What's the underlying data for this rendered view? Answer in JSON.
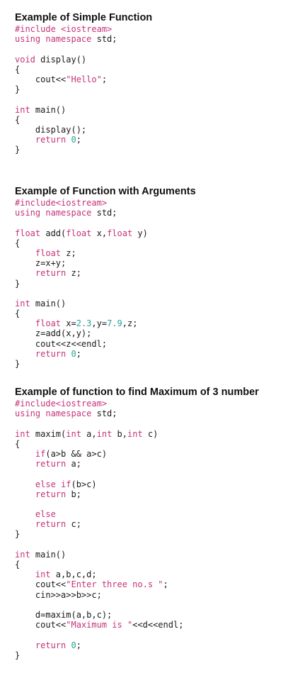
{
  "sections": [
    {
      "title": "Example of Simple Function",
      "lines": [
        [
          {
            "t": "kw",
            "v": "#include <iostream>"
          }
        ],
        [
          {
            "t": "kw",
            "v": "using namespace"
          },
          {
            "t": "tx",
            "v": " std;"
          }
        ],
        [],
        [
          {
            "t": "kw",
            "v": "void"
          },
          {
            "t": "tx",
            "v": " display()"
          }
        ],
        [
          {
            "t": "tx",
            "v": "{"
          }
        ],
        [
          {
            "t": "tx",
            "v": "    cout<<"
          },
          {
            "t": "st",
            "v": "\"Hello\""
          },
          {
            "t": "tx",
            "v": ";"
          }
        ],
        [
          {
            "t": "tx",
            "v": "}"
          }
        ],
        [],
        [
          {
            "t": "kw",
            "v": "int"
          },
          {
            "t": "tx",
            "v": " main()"
          }
        ],
        [
          {
            "t": "tx",
            "v": "{"
          }
        ],
        [
          {
            "t": "tx",
            "v": "    display();"
          }
        ],
        [
          {
            "t": "kw",
            "v": "    return"
          },
          {
            "t": "tx",
            "v": " "
          },
          {
            "t": "nm",
            "v": "0"
          },
          {
            "t": "tx",
            "v": ";"
          }
        ],
        [
          {
            "t": "tx",
            "v": "}"
          }
        ]
      ]
    },
    {
      "title": "Example of Function with Arguments",
      "lines": [
        [
          {
            "t": "kw",
            "v": "#include<iostream>"
          }
        ],
        [
          {
            "t": "kw",
            "v": "using namespace"
          },
          {
            "t": "tx",
            "v": " std;"
          }
        ],
        [],
        [
          {
            "t": "kw",
            "v": "float"
          },
          {
            "t": "tx",
            "v": " add("
          },
          {
            "t": "kw",
            "v": "float"
          },
          {
            "t": "tx",
            "v": " x,"
          },
          {
            "t": "kw",
            "v": "float"
          },
          {
            "t": "tx",
            "v": " y)"
          }
        ],
        [
          {
            "t": "tx",
            "v": "{"
          }
        ],
        [
          {
            "t": "kw",
            "v": "    float"
          },
          {
            "t": "tx",
            "v": " z;"
          }
        ],
        [
          {
            "t": "tx",
            "v": "    z=x+y;"
          }
        ],
        [
          {
            "t": "kw",
            "v": "    return"
          },
          {
            "t": "tx",
            "v": " z;"
          }
        ],
        [
          {
            "t": "tx",
            "v": "}"
          }
        ],
        [],
        [
          {
            "t": "kw",
            "v": "int"
          },
          {
            "t": "tx",
            "v": " main()"
          }
        ],
        [
          {
            "t": "tx",
            "v": "{"
          }
        ],
        [
          {
            "t": "kw",
            "v": "    float"
          },
          {
            "t": "tx",
            "v": " x="
          },
          {
            "t": "nm",
            "v": "2.3"
          },
          {
            "t": "tx",
            "v": ",y="
          },
          {
            "t": "nm",
            "v": "7.9"
          },
          {
            "t": "tx",
            "v": ",z;"
          }
        ],
        [
          {
            "t": "tx",
            "v": "    z=add(x,y);"
          }
        ],
        [
          {
            "t": "tx",
            "v": "    cout<<z<<endl;"
          }
        ],
        [
          {
            "t": "kw",
            "v": "    return"
          },
          {
            "t": "tx",
            "v": " "
          },
          {
            "t": "nm",
            "v": "0"
          },
          {
            "t": "tx",
            "v": ";"
          }
        ],
        [
          {
            "t": "tx",
            "v": "}"
          }
        ]
      ]
    },
    {
      "title": "Example of function to find Maximum of 3 number",
      "lines": [
        [
          {
            "t": "kw",
            "v": "#include<iostream>"
          }
        ],
        [
          {
            "t": "kw",
            "v": "using namespace"
          },
          {
            "t": "tx",
            "v": " std;"
          }
        ],
        [],
        [
          {
            "t": "kw",
            "v": "int"
          },
          {
            "t": "tx",
            "v": " maxim("
          },
          {
            "t": "kw",
            "v": "int"
          },
          {
            "t": "tx",
            "v": " a,"
          },
          {
            "t": "kw",
            "v": "int"
          },
          {
            "t": "tx",
            "v": " b,"
          },
          {
            "t": "kw",
            "v": "int"
          },
          {
            "t": "tx",
            "v": " c)"
          }
        ],
        [
          {
            "t": "tx",
            "v": "{"
          }
        ],
        [
          {
            "t": "kw",
            "v": "    if"
          },
          {
            "t": "tx",
            "v": "(a>b && a>c)"
          }
        ],
        [
          {
            "t": "kw",
            "v": "    return"
          },
          {
            "t": "tx",
            "v": " a;"
          }
        ],
        [],
        [
          {
            "t": "kw",
            "v": "    else if"
          },
          {
            "t": "tx",
            "v": "(b>c)"
          }
        ],
        [
          {
            "t": "kw",
            "v": "    return"
          },
          {
            "t": "tx",
            "v": " b;"
          }
        ],
        [],
        [
          {
            "t": "kw",
            "v": "    else"
          }
        ],
        [
          {
            "t": "kw",
            "v": "    return"
          },
          {
            "t": "tx",
            "v": " c;"
          }
        ],
        [
          {
            "t": "tx",
            "v": "}"
          }
        ],
        [],
        [
          {
            "t": "kw",
            "v": "int"
          },
          {
            "t": "tx",
            "v": " main()"
          }
        ],
        [
          {
            "t": "tx",
            "v": "{"
          }
        ],
        [
          {
            "t": "kw",
            "v": "    int"
          },
          {
            "t": "tx",
            "v": " a,b,c,d;"
          }
        ],
        [
          {
            "t": "tx",
            "v": "    cout<<"
          },
          {
            "t": "st",
            "v": "\"Enter three no.s \""
          },
          {
            "t": "tx",
            "v": ";"
          }
        ],
        [
          {
            "t": "tx",
            "v": "    cin>>a>>b>>c;"
          }
        ],
        [],
        [
          {
            "t": "tx",
            "v": "    d=maxim(a,b,c);"
          }
        ],
        [
          {
            "t": "tx",
            "v": "    cout<<"
          },
          {
            "t": "st",
            "v": "\"Maximum is \""
          },
          {
            "t": "tx",
            "v": "<<d<<endl;"
          }
        ],
        [],
        [
          {
            "t": "kw",
            "v": "    return"
          },
          {
            "t": "tx",
            "v": " "
          },
          {
            "t": "nm",
            "v": "0"
          },
          {
            "t": "tx",
            "v": ";"
          }
        ],
        [
          {
            "t": "tx",
            "v": "}"
          }
        ]
      ]
    }
  ]
}
